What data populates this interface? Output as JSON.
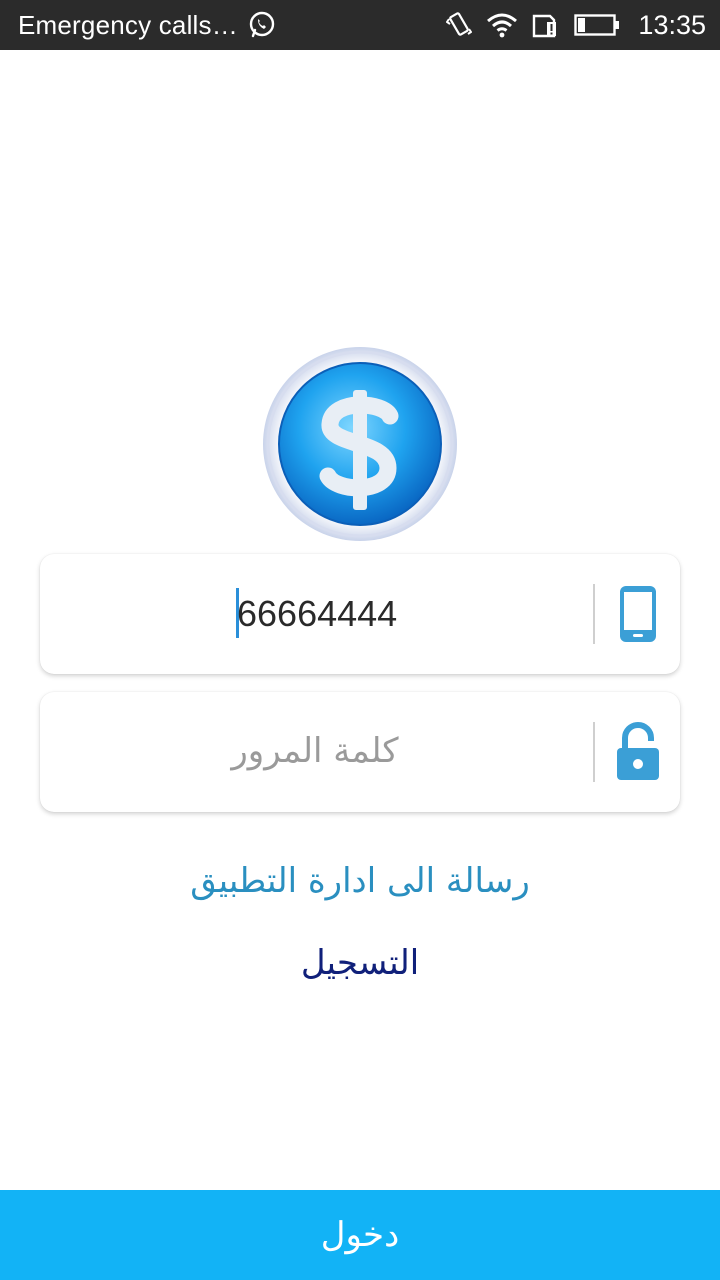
{
  "status_bar": {
    "carrier_text": "Emergency calls…",
    "time": "13:35",
    "icons": [
      "whatsapp-icon",
      "vibrate-icon",
      "wifi-icon",
      "sim-alert-icon",
      "battery-icon"
    ]
  },
  "logo": {
    "icon": "dollar-coin-icon"
  },
  "phone_field": {
    "value": "66664444",
    "icon": "mobile-phone-icon"
  },
  "password_field": {
    "placeholder": "كلمة  المرور",
    "icon": "unlock-icon"
  },
  "links": {
    "contact_admin": "رسالة الى ادارة التطبيق",
    "register": "التسجيل"
  },
  "login_button": {
    "label": "دخول"
  },
  "colors": {
    "status_bar": "#2b2b2b",
    "accent": "#12b3f6",
    "icon_blue": "#3b9fd6",
    "link_blue": "#2a8fc0",
    "register_navy": "#10207a"
  }
}
